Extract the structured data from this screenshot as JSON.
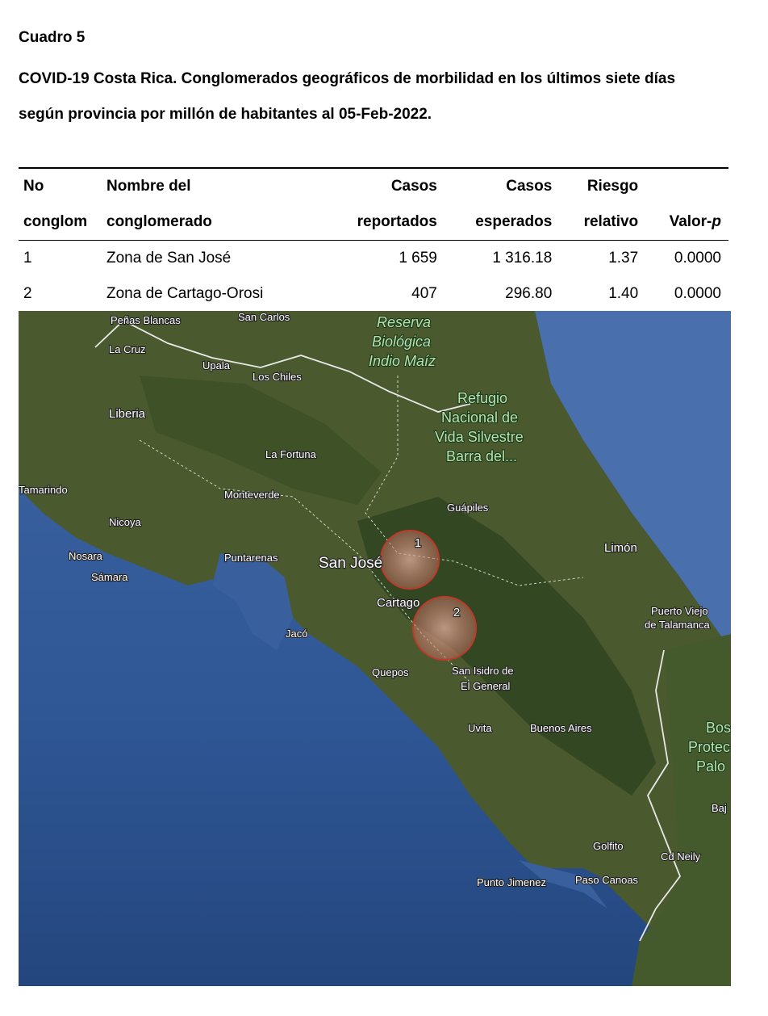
{
  "document": {
    "label": "Cuadro 5",
    "title_line1": "COVID-19 Costa Rica. Conglomerados geográficos de morbilidad en los últimos siete días",
    "title_line2": "según provincia por millón de habitantes al 05-Feb-2022."
  },
  "table": {
    "headers_row1": [
      "No",
      "Nombre del",
      "Casos",
      "Casos",
      "Riesgo",
      ""
    ],
    "headers_row2": [
      "conglom",
      "conglomerado",
      "reportados",
      "esperados",
      "relativo",
      "Valor-"
    ],
    "p_italic": "p",
    "rows": [
      [
        "1",
        "Zona de San José",
        "1 659",
        "1 316.18",
        "1.37",
        "0.0000"
      ],
      [
        "2",
        "Zona de Cartago-Orosi",
        "407",
        "296.80",
        "1.40",
        "0.0000"
      ]
    ]
  },
  "map": {
    "colors": {
      "ocean": "#2f5795",
      "land": "#4a5a2e",
      "forest": "#2f4420",
      "cluster": "#c0392b"
    },
    "clusters": [
      {
        "label": "1"
      },
      {
        "label": "2"
      }
    ],
    "places": {
      "penas_blancas": "Peñas Blancas",
      "san_carlos": "San Carlos",
      "la_cruz": "La Cruz",
      "upala": "Upala",
      "los_chiles": "Los Chiles",
      "liberia": "Liberia",
      "la_fortuna": "La Fortuna",
      "tamarindo": "Tamarindo",
      "monteverde": "Monteverde",
      "nicoya": "Nicoya",
      "nosara": "Nosara",
      "samara": "Sámara",
      "puntarenas": "Puntarenas",
      "san_jose": "San José",
      "cartago": "Cartago",
      "guapiles": "Guápiles",
      "limon": "Limón",
      "jaco": "Jacó",
      "quepos": "Quepos",
      "san_isidro_1": "San Isidro de",
      "san_isidro_2": "El General",
      "uvita": "Uvita",
      "buenos_aires": "Buenos Aires",
      "puerto_viejo_1": "Puerto Viejo",
      "puerto_viejo_2": "de Talamanca",
      "golfito": "Golfito",
      "cd_neily": "Cd Neily",
      "punto_jimenez": "Punto Jimenez",
      "paso_canoas": "Paso Canoas",
      "reserva_1": "Reserva",
      "reserva_2": "Biológica",
      "reserva_3": "Indio Maíz",
      "refugio_1": "Refugio",
      "refugio_2": "Nacional de",
      "refugio_3": "Vida Silvestre",
      "refugio_4": "Barra del...",
      "bos_1": "Bos",
      "bos_2": "Protec",
      "bos_3": "Palo",
      "baj": "Baj"
    }
  }
}
